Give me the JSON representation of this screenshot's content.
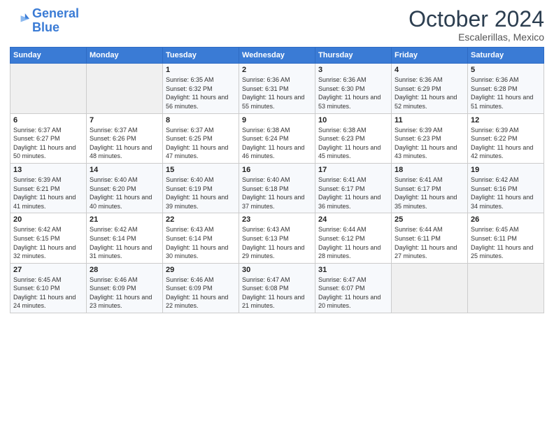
{
  "logo": {
    "line1": "General",
    "line2": "Blue"
  },
  "title": "October 2024",
  "subtitle": "Escalerillas, Mexico",
  "days_header": [
    "Sunday",
    "Monday",
    "Tuesday",
    "Wednesday",
    "Thursday",
    "Friday",
    "Saturday"
  ],
  "weeks": [
    [
      {
        "day": "",
        "empty": true
      },
      {
        "day": "",
        "empty": true
      },
      {
        "day": "1",
        "sunrise": "Sunrise: 6:35 AM",
        "sunset": "Sunset: 6:32 PM",
        "daylight": "Daylight: 11 hours and 56 minutes."
      },
      {
        "day": "2",
        "sunrise": "Sunrise: 6:36 AM",
        "sunset": "Sunset: 6:31 PM",
        "daylight": "Daylight: 11 hours and 55 minutes."
      },
      {
        "day": "3",
        "sunrise": "Sunrise: 6:36 AM",
        "sunset": "Sunset: 6:30 PM",
        "daylight": "Daylight: 11 hours and 53 minutes."
      },
      {
        "day": "4",
        "sunrise": "Sunrise: 6:36 AM",
        "sunset": "Sunset: 6:29 PM",
        "daylight": "Daylight: 11 hours and 52 minutes."
      },
      {
        "day": "5",
        "sunrise": "Sunrise: 6:36 AM",
        "sunset": "Sunset: 6:28 PM",
        "daylight": "Daylight: 11 hours and 51 minutes."
      }
    ],
    [
      {
        "day": "6",
        "sunrise": "Sunrise: 6:37 AM",
        "sunset": "Sunset: 6:27 PM",
        "daylight": "Daylight: 11 hours and 50 minutes."
      },
      {
        "day": "7",
        "sunrise": "Sunrise: 6:37 AM",
        "sunset": "Sunset: 6:26 PM",
        "daylight": "Daylight: 11 hours and 48 minutes."
      },
      {
        "day": "8",
        "sunrise": "Sunrise: 6:37 AM",
        "sunset": "Sunset: 6:25 PM",
        "daylight": "Daylight: 11 hours and 47 minutes."
      },
      {
        "day": "9",
        "sunrise": "Sunrise: 6:38 AM",
        "sunset": "Sunset: 6:24 PM",
        "daylight": "Daylight: 11 hours and 46 minutes."
      },
      {
        "day": "10",
        "sunrise": "Sunrise: 6:38 AM",
        "sunset": "Sunset: 6:23 PM",
        "daylight": "Daylight: 11 hours and 45 minutes."
      },
      {
        "day": "11",
        "sunrise": "Sunrise: 6:39 AM",
        "sunset": "Sunset: 6:23 PM",
        "daylight": "Daylight: 11 hours and 43 minutes."
      },
      {
        "day": "12",
        "sunrise": "Sunrise: 6:39 AM",
        "sunset": "Sunset: 6:22 PM",
        "daylight": "Daylight: 11 hours and 42 minutes."
      }
    ],
    [
      {
        "day": "13",
        "sunrise": "Sunrise: 6:39 AM",
        "sunset": "Sunset: 6:21 PM",
        "daylight": "Daylight: 11 hours and 41 minutes."
      },
      {
        "day": "14",
        "sunrise": "Sunrise: 6:40 AM",
        "sunset": "Sunset: 6:20 PM",
        "daylight": "Daylight: 11 hours and 40 minutes."
      },
      {
        "day": "15",
        "sunrise": "Sunrise: 6:40 AM",
        "sunset": "Sunset: 6:19 PM",
        "daylight": "Daylight: 11 hours and 39 minutes."
      },
      {
        "day": "16",
        "sunrise": "Sunrise: 6:40 AM",
        "sunset": "Sunset: 6:18 PM",
        "daylight": "Daylight: 11 hours and 37 minutes."
      },
      {
        "day": "17",
        "sunrise": "Sunrise: 6:41 AM",
        "sunset": "Sunset: 6:17 PM",
        "daylight": "Daylight: 11 hours and 36 minutes."
      },
      {
        "day": "18",
        "sunrise": "Sunrise: 6:41 AM",
        "sunset": "Sunset: 6:17 PM",
        "daylight": "Daylight: 11 hours and 35 minutes."
      },
      {
        "day": "19",
        "sunrise": "Sunrise: 6:42 AM",
        "sunset": "Sunset: 6:16 PM",
        "daylight": "Daylight: 11 hours and 34 minutes."
      }
    ],
    [
      {
        "day": "20",
        "sunrise": "Sunrise: 6:42 AM",
        "sunset": "Sunset: 6:15 PM",
        "daylight": "Daylight: 11 hours and 32 minutes."
      },
      {
        "day": "21",
        "sunrise": "Sunrise: 6:42 AM",
        "sunset": "Sunset: 6:14 PM",
        "daylight": "Daylight: 11 hours and 31 minutes."
      },
      {
        "day": "22",
        "sunrise": "Sunrise: 6:43 AM",
        "sunset": "Sunset: 6:14 PM",
        "daylight": "Daylight: 11 hours and 30 minutes."
      },
      {
        "day": "23",
        "sunrise": "Sunrise: 6:43 AM",
        "sunset": "Sunset: 6:13 PM",
        "daylight": "Daylight: 11 hours and 29 minutes."
      },
      {
        "day": "24",
        "sunrise": "Sunrise: 6:44 AM",
        "sunset": "Sunset: 6:12 PM",
        "daylight": "Daylight: 11 hours and 28 minutes."
      },
      {
        "day": "25",
        "sunrise": "Sunrise: 6:44 AM",
        "sunset": "Sunset: 6:11 PM",
        "daylight": "Daylight: 11 hours and 27 minutes."
      },
      {
        "day": "26",
        "sunrise": "Sunrise: 6:45 AM",
        "sunset": "Sunset: 6:11 PM",
        "daylight": "Daylight: 11 hours and 25 minutes."
      }
    ],
    [
      {
        "day": "27",
        "sunrise": "Sunrise: 6:45 AM",
        "sunset": "Sunset: 6:10 PM",
        "daylight": "Daylight: 11 hours and 24 minutes."
      },
      {
        "day": "28",
        "sunrise": "Sunrise: 6:46 AM",
        "sunset": "Sunset: 6:09 PM",
        "daylight": "Daylight: 11 hours and 23 minutes."
      },
      {
        "day": "29",
        "sunrise": "Sunrise: 6:46 AM",
        "sunset": "Sunset: 6:09 PM",
        "daylight": "Daylight: 11 hours and 22 minutes."
      },
      {
        "day": "30",
        "sunrise": "Sunrise: 6:47 AM",
        "sunset": "Sunset: 6:08 PM",
        "daylight": "Daylight: 11 hours and 21 minutes."
      },
      {
        "day": "31",
        "sunrise": "Sunrise: 6:47 AM",
        "sunset": "Sunset: 6:07 PM",
        "daylight": "Daylight: 11 hours and 20 minutes."
      },
      {
        "day": "",
        "empty": true
      },
      {
        "day": "",
        "empty": true
      }
    ]
  ]
}
